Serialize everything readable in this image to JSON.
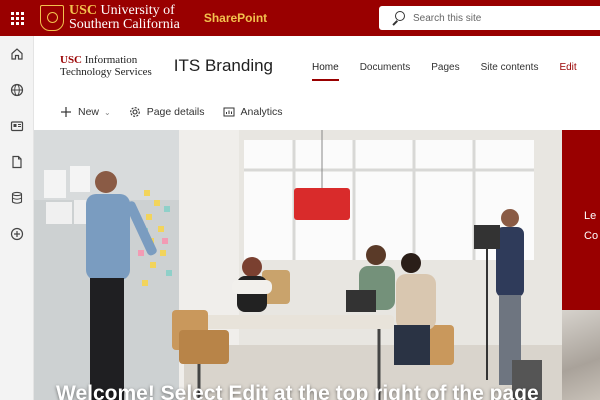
{
  "topbar": {
    "logo_line1_usc": "USC",
    "logo_line1_rest": " University of",
    "logo_line2": "Southern California",
    "app_name": "SharePoint",
    "search_placeholder": "Search this site"
  },
  "site": {
    "logo_usc": "USC",
    "logo_line1_rest": " Information",
    "logo_line2": "Technology Services",
    "title": "ITS Branding"
  },
  "nav": [
    {
      "label": "Home",
      "active": true
    },
    {
      "label": "Documents"
    },
    {
      "label": "Pages"
    },
    {
      "label": "Site contents"
    },
    {
      "label": "Edit"
    }
  ],
  "commands": {
    "new_label": "New",
    "page_details_label": "Page details",
    "analytics_label": "Analytics"
  },
  "rail_icons": [
    "home-icon",
    "globe-icon",
    "news-icon",
    "file-icon",
    "database-icon",
    "add-circle-icon"
  ],
  "hero": {
    "caption": "Welcome! Select Edit at the top right of the page"
  },
  "side_panel": {
    "text_line1": "Le",
    "text_line2": "Co"
  },
  "colors": {
    "brand": "#990000",
    "accent": "#f2c14e"
  }
}
